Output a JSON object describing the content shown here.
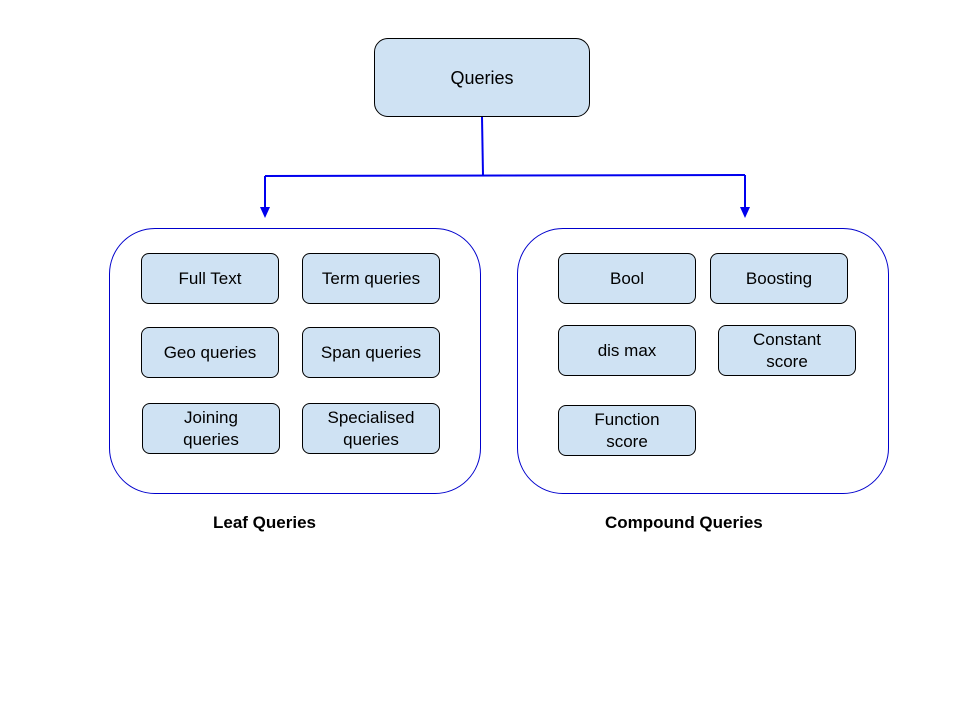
{
  "root": {
    "label": "Queries"
  },
  "groups": {
    "leaf": {
      "caption": "Leaf Queries",
      "items": [
        {
          "label": "Full Text"
        },
        {
          "label": "Term queries"
        },
        {
          "label": "Geo queries"
        },
        {
          "label": "Span queries"
        },
        {
          "label": "Joining\nqueries"
        },
        {
          "label": "Specialised\nqueries"
        }
      ]
    },
    "compound": {
      "caption": "Compound Queries",
      "items": [
        {
          "label": "Bool"
        },
        {
          "label": "Boosting"
        },
        {
          "label": "dis max"
        },
        {
          "label": "Constant\nscore"
        },
        {
          "label": "Function\nscore"
        }
      ]
    }
  },
  "colors": {
    "node_fill": "#cfe2f3",
    "node_border": "#000000",
    "connector": "#0000ee",
    "group_border": "#0000cc"
  }
}
